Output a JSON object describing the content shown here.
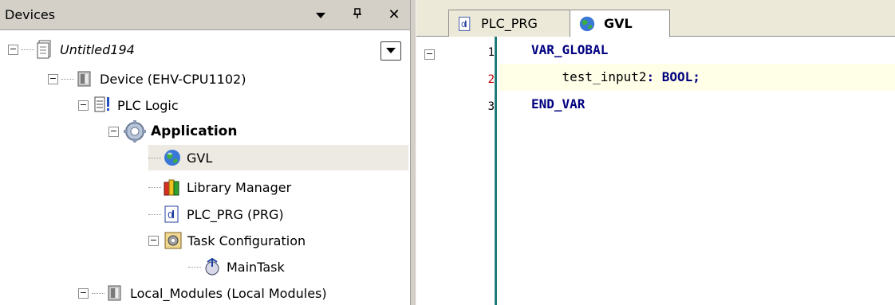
{
  "devices_panel": {
    "title": "Devices",
    "buttons": {
      "dropdown": "▼",
      "pin": "ᵖ",
      "close": "✕"
    },
    "tree": [
      {
        "label": "Untitled194",
        "icon": "project-icon",
        "expanded": true
      },
      {
        "label": "Device (EHV-CPU1102)",
        "icon": "device-icon",
        "expanded": true
      },
      {
        "label": "PLC Logic",
        "icon": "plc-logic-icon",
        "expanded": true
      },
      {
        "label": "Application",
        "icon": "application-gear-icon",
        "expanded": true
      },
      {
        "label": "GVL",
        "icon": "globe-icon",
        "selected": true
      },
      {
        "label": "Library Manager",
        "icon": "library-books-icon"
      },
      {
        "label": "PLC_PRG (PRG)",
        "icon": "program-icon"
      },
      {
        "label": "Task Configuration",
        "icon": "task-config-icon",
        "expanded": true
      },
      {
        "label": "MainTask",
        "icon": "task-icon"
      },
      {
        "label": "Local_Modules (Local Modules)",
        "icon": "module-icon",
        "expanded": true
      }
    ]
  },
  "editor": {
    "tabs": [
      {
        "label": "PLC_PRG",
        "icon": "program-icon",
        "active": false
      },
      {
        "label": "GVL",
        "icon": "globe-icon",
        "active": true
      }
    ],
    "lines": [
      {
        "num": "1",
        "kw1": "VAR_GLOBAL",
        "text": "",
        "kw2": ""
      },
      {
        "num": "2",
        "kw1": "",
        "text": "    test_input2",
        "kw2": ": BOOL;"
      },
      {
        "num": "3",
        "kw1": "END_VAR",
        "text": "",
        "kw2": ""
      }
    ]
  },
  "colors": {
    "keyword": "#000080",
    "gutter_line": "#1f7a7a",
    "current_line": "#ffffe8",
    "line_number_current": "#c00000"
  }
}
